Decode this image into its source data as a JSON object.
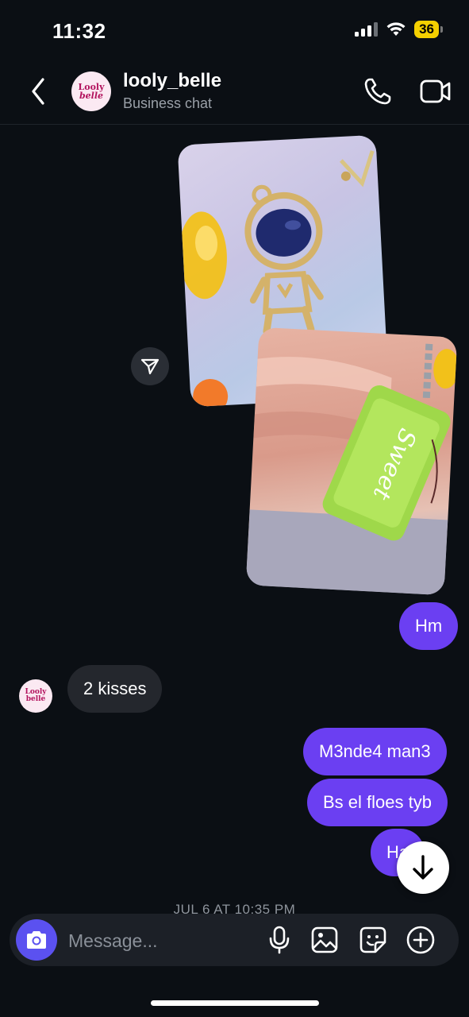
{
  "status_bar": {
    "time": "11:32",
    "battery": "36"
  },
  "header": {
    "contact_name": "looly_belle",
    "subtitle": "Business chat",
    "avatar_logo": [
      "Looly",
      "belle"
    ]
  },
  "messages": [
    {
      "side": "out",
      "text": "Hm"
    },
    {
      "side": "in",
      "text": "2 kisses"
    },
    {
      "side": "out",
      "text": "M3nde4 man3"
    },
    {
      "side": "out",
      "text": "Bs el floes tyb"
    },
    {
      "side": "out",
      "text": "Ha"
    }
  ],
  "photos": [
    {
      "content_text": "Sweet"
    }
  ],
  "date_separator": "JUL 6 AT 10:35 PM",
  "composer": {
    "placeholder": "Message..."
  },
  "colors": {
    "outgoing_bubble": "#6b3ff2",
    "incoming_bubble": "#24272d",
    "camera_button": "#5b51f0",
    "background": "#0b0f14"
  },
  "icons": [
    "back-chevron-icon",
    "phone-icon",
    "video-camera-icon",
    "share-icon",
    "arrow-down-icon",
    "camera-icon",
    "microphone-icon",
    "gallery-icon",
    "sticker-icon",
    "plus-circle-icon"
  ]
}
